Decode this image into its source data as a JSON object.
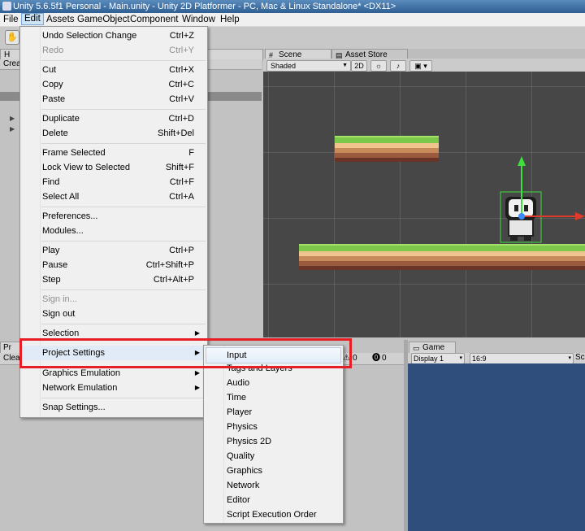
{
  "window": {
    "title": "Unity 5.6.5f1 Personal - Main.unity - Unity 2D Platformer - PC, Mac & Linux Standalone* <DX11>"
  },
  "menubar": {
    "items": [
      "File",
      "Edit",
      "Assets",
      "GameObject",
      "Component",
      "Window",
      "Help"
    ]
  },
  "left_panel": {
    "tab_label": "H",
    "create_label": "Crea"
  },
  "scene": {
    "tabs": [
      "Scene",
      "Asset Store"
    ],
    "shading_mode": "Shaded",
    "mode_2d": "2D"
  },
  "bottom": {
    "project_tab": "Pr",
    "clear_label": "Clea",
    "game_tab": "Game",
    "display": "Display 1",
    "aspect": "16:9",
    "scale_label": "Sc",
    "counts": [
      "0",
      "0"
    ]
  },
  "edit_menu": {
    "items": [
      {
        "label": "Undo Selection Change",
        "shortcut": "Ctrl+Z"
      },
      {
        "label": "Redo",
        "shortcut": "Ctrl+Y"
      },
      {
        "label": "Cut",
        "shortcut": "Ctrl+X"
      },
      {
        "label": "Copy",
        "shortcut": "Ctrl+C"
      },
      {
        "label": "Paste",
        "shortcut": "Ctrl+V"
      },
      {
        "label": "Duplicate",
        "shortcut": "Ctrl+D"
      },
      {
        "label": "Delete",
        "shortcut": "Shift+Del"
      },
      {
        "label": "Frame Selected",
        "shortcut": "F"
      },
      {
        "label": "Lock View to Selected",
        "shortcut": "Shift+F"
      },
      {
        "label": "Find",
        "shortcut": "Ctrl+F"
      },
      {
        "label": "Select All",
        "shortcut": "Ctrl+A"
      },
      {
        "label": "Preferences...",
        "shortcut": ""
      },
      {
        "label": "Modules...",
        "shortcut": ""
      },
      {
        "label": "Play",
        "shortcut": "Ctrl+P"
      },
      {
        "label": "Pause",
        "shortcut": "Ctrl+Shift+P"
      },
      {
        "label": "Step",
        "shortcut": "Ctrl+Alt+P"
      },
      {
        "label": "Sign in...",
        "shortcut": ""
      },
      {
        "label": "Sign out",
        "shortcut": ""
      },
      {
        "label": "Selection",
        "shortcut": ""
      },
      {
        "label": "Project Settings",
        "shortcut": ""
      },
      {
        "label": "Graphics Emulation",
        "shortcut": ""
      },
      {
        "label": "Network Emulation",
        "shortcut": ""
      },
      {
        "label": "Snap Settings...",
        "shortcut": ""
      }
    ]
  },
  "project_settings_menu": {
    "items": [
      "Input",
      "Tags and Layers",
      "Audio",
      "Time",
      "Player",
      "Physics",
      "Physics 2D",
      "Quality",
      "Graphics",
      "Network",
      "Editor",
      "Script Execution Order"
    ]
  },
  "colors": {
    "highlight_box": "#e61f26",
    "game_background": "#2f4e7c",
    "scene_background": "#474747"
  }
}
